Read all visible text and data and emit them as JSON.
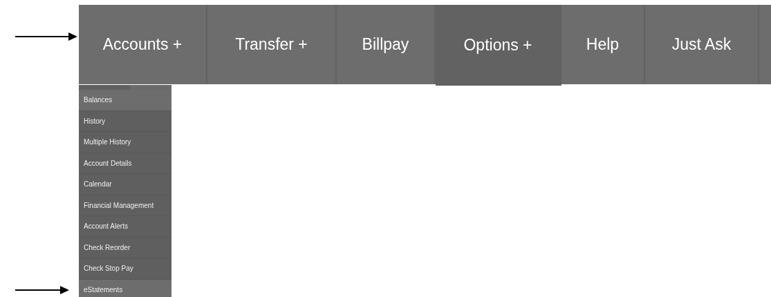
{
  "menu": [
    {
      "label": "Accounts +",
      "selected": false
    },
    {
      "label": "Transfer +",
      "selected": false
    },
    {
      "label": "Billpay",
      "selected": false
    },
    {
      "label": "Options +",
      "selected": true
    },
    {
      "label": "Help",
      "selected": false
    },
    {
      "label": "Just Ask",
      "selected": false
    }
  ],
  "dropdown": [
    {
      "label": "Balances",
      "selected": true
    },
    {
      "label": "History",
      "selected": false
    },
    {
      "label": "Multiple History",
      "selected": false
    },
    {
      "label": "Account Details",
      "selected": false
    },
    {
      "label": "Calendar",
      "selected": false
    },
    {
      "label": "Financial Management",
      "selected": false
    },
    {
      "label": "Account Alerts",
      "selected": false
    },
    {
      "label": "Check Reorder",
      "selected": false
    },
    {
      "label": "Check Stop Pay",
      "selected": false
    },
    {
      "label": "eStatements",
      "selected": true
    }
  ],
  "annotations": [
    {
      "kind": "arrow"
    },
    {
      "kind": "arrow"
    }
  ]
}
